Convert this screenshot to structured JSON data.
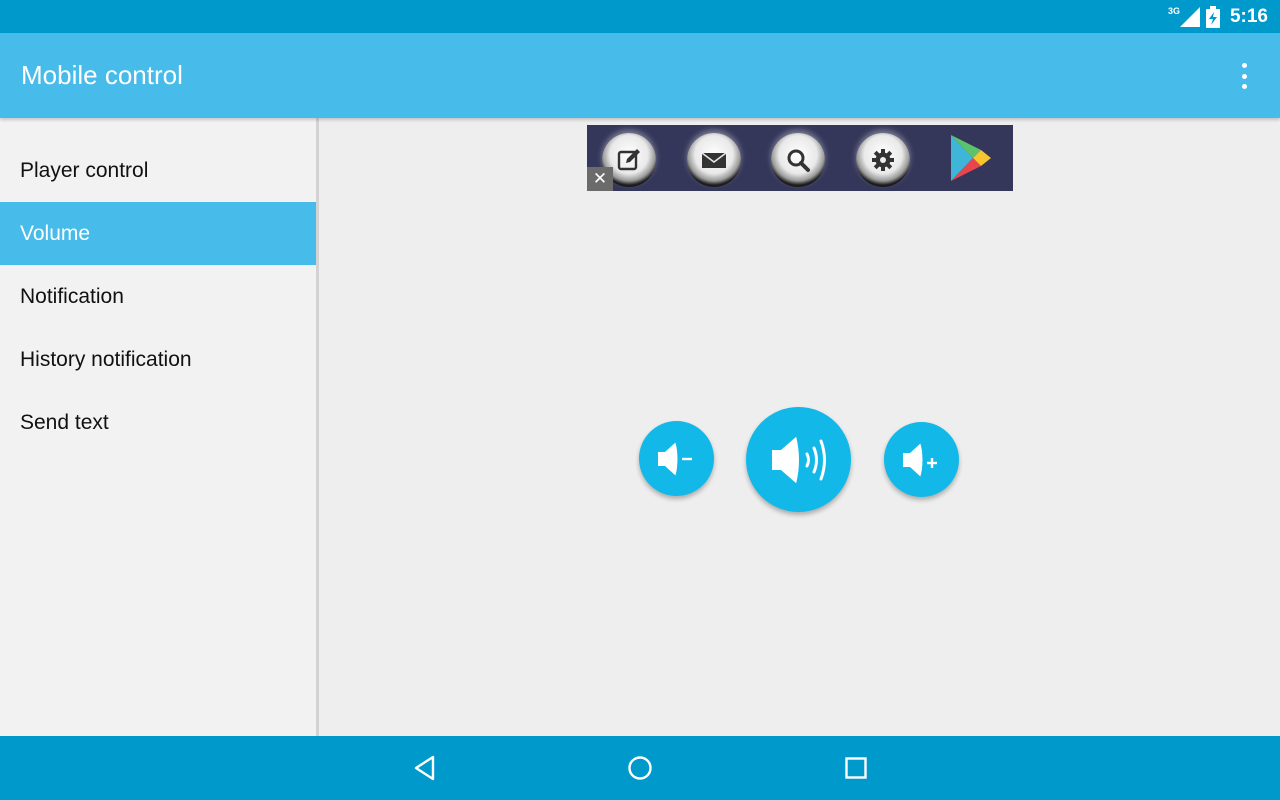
{
  "status_bar": {
    "network_type": "3G",
    "time": "5:16",
    "icons": [
      "signal-icon",
      "battery-charging-icon"
    ]
  },
  "action_bar": {
    "title": "Mobile control",
    "overflow_icon": "overflow-menu-icon"
  },
  "sidebar": {
    "selected_index": 1,
    "items": [
      {
        "label": "Player control"
      },
      {
        "label": "Volume"
      },
      {
        "label": "Notification"
      },
      {
        "label": "History notification"
      },
      {
        "label": "Send text"
      }
    ]
  },
  "ad_banner": {
    "close_label": "✕",
    "icons": [
      "edit-icon",
      "mail-icon",
      "search-icon",
      "settings-icon",
      "google-play-icon"
    ]
  },
  "volume_controls": {
    "icons": [
      "volume-down-icon",
      "volume-mute-icon",
      "volume-up-icon"
    ]
  },
  "nav_bar": {
    "icons": [
      "back-icon",
      "home-icon",
      "recents-icon"
    ]
  },
  "colors": {
    "status_bar": "#0099cc",
    "action_bar": "#47bbe9",
    "accent": "#12b8e8",
    "sidebar_bg": "#f2f2f2",
    "content_bg": "#eeeeee",
    "ad_bg": "#34375a"
  }
}
